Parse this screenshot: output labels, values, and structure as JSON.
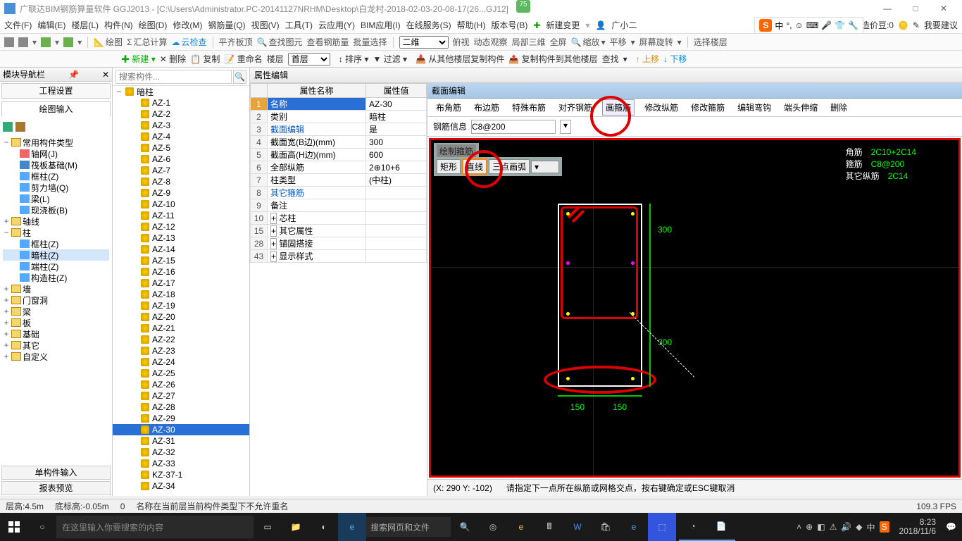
{
  "title": "广联达BIM钢筋算量软件 GGJ2013 - [C:\\Users\\Administrator.PC-20141127NRHM\\Desktop\\白龙村-2018-02-03-20-08-17(26...GJ12]",
  "badge": "75",
  "menubar": [
    "文件(F)",
    "编辑(E)",
    "楼层(L)",
    "构件(N)",
    "绘图(D)",
    "修改(M)",
    "钢筋量(Q)",
    "视图(V)",
    "工具(T)",
    "云应用(Y)",
    "BIM应用(I)",
    "在线服务(S)",
    "帮助(H)",
    "版本号(B)"
  ],
  "menu_right": {
    "new": "新建变更",
    "user": "广小二",
    "price": "造价豆:0",
    "feedback": "我要建议"
  },
  "toolbar1": [
    "绘图",
    "汇总计算",
    "云检查",
    "平齐板顶",
    "查找图元",
    "查看钢筋量",
    "批量选择",
    "二维",
    "俯视",
    "动态观察",
    "局部三维",
    "全屏",
    "缩放",
    "平移",
    "屏幕旋转",
    "选择楼层"
  ],
  "toolbar2": [
    "新建",
    "删除",
    "复制",
    "重命名",
    "楼层",
    "首层",
    "排序",
    "过滤",
    "从其他楼层复制构件",
    "复制构件到其他楼层",
    "查找",
    "上移",
    "下移"
  ],
  "dock": {
    "title": "模块导航栏",
    "tab1": "工程设置",
    "tab2": "绘图输入"
  },
  "tree": {
    "root": "常用构件类型",
    "items": [
      "轴网(J)",
      "筏板基础(M)",
      "框柱(Z)",
      "剪力墙(Q)",
      "梁(L)",
      "现浇板(B)"
    ],
    "n1": "轴线",
    "n2": "柱",
    "cols": [
      "框柱(Z)",
      "暗柱(Z)",
      "端柱(Z)",
      "构造柱(Z)"
    ],
    "others": [
      "墙",
      "门窗洞",
      "梁",
      "板",
      "基础",
      "其它",
      "自定义"
    ]
  },
  "bottom_tabs": [
    "单构件输入",
    "报表预览"
  ],
  "search_placeholder": "搜索构件...",
  "list_root": "暗柱",
  "list": [
    "AZ-1",
    "AZ-2",
    "AZ-3",
    "AZ-4",
    "AZ-5",
    "AZ-6",
    "AZ-7",
    "AZ-8",
    "AZ-9",
    "AZ-10",
    "AZ-11",
    "AZ-12",
    "AZ-13",
    "AZ-14",
    "AZ-15",
    "AZ-16",
    "AZ-17",
    "AZ-18",
    "AZ-19",
    "AZ-20",
    "AZ-21",
    "AZ-22",
    "AZ-23",
    "AZ-24",
    "AZ-25",
    "AZ-26",
    "AZ-27",
    "AZ-28",
    "AZ-29",
    "AZ-30",
    "AZ-31",
    "AZ-32",
    "AZ-33",
    "KZ-37-1",
    "AZ-34"
  ],
  "list_selected": "AZ-30",
  "prop_title": "属性编辑",
  "prop_head": {
    "name": "属性名称",
    "val": "属性值"
  },
  "props": [
    {
      "n": "1",
      "k": "名称",
      "v": "AZ-30",
      "sel": true
    },
    {
      "n": "2",
      "k": "类别",
      "v": "暗柱"
    },
    {
      "n": "3",
      "k": "截面编辑",
      "v": "是",
      "blue": true
    },
    {
      "n": "4",
      "k": "截面宽(B边)(mm)",
      "v": "300"
    },
    {
      "n": "5",
      "k": "截面高(H边)(mm)",
      "v": "600"
    },
    {
      "n": "6",
      "k": "全部纵筋",
      "v": "2⊕10+6"
    },
    {
      "n": "7",
      "k": "柱类型",
      "v": "(中柱)"
    },
    {
      "n": "8",
      "k": "其它箍筋",
      "v": "",
      "blue": true
    },
    {
      "n": "9",
      "k": "备注",
      "v": ""
    },
    {
      "n": "10",
      "k": "芯柱",
      "v": "",
      "plus": true
    },
    {
      "n": "15",
      "k": "其它属性",
      "v": "",
      "plus": true
    },
    {
      "n": "28",
      "k": "锚固搭接",
      "v": "",
      "plus": true
    },
    {
      "n": "43",
      "k": "显示样式",
      "v": "",
      "plus": true
    }
  ],
  "section": {
    "title": "截面编辑",
    "tabs": [
      "布角筋",
      "布边筋",
      "特殊布筋",
      "对齐钢筋",
      "画箍筋",
      "修改纵筋",
      "修改箍筋",
      "编辑弯钩",
      "端头伸缩",
      "删除"
    ],
    "active": "画箍筋",
    "info_label": "钢筋信息",
    "info_val": "C8@200",
    "draw_title": "绘制箍筋",
    "draw_btns": [
      "矩形",
      "直线",
      "三点画弧"
    ],
    "legend": {
      "a": "角筋",
      "av": "2C10+2C14",
      "b": "箍筋",
      "bv": "C8@200",
      "c": "其它纵筋",
      "cv": "2C14"
    },
    "dim300": "300",
    "dim150": "150",
    "coords": "(X: 290 Y: -102)",
    "hint": "请指定下一点所在纵筋或网格交点，按右键确定或ESC键取消"
  },
  "status": {
    "floor": "层高:4.5m",
    "bottom": "底标高:-0.05m",
    "cur": "0",
    "msg": "名称在当前层当前构件类型下不允许重名",
    "fps": "109.3 FPS"
  },
  "taskbar": {
    "search": "在这里输入你要搜索的内容",
    "browser": "搜索网页和文件",
    "ime": "中",
    "time": "8:23",
    "date": "2018/11/6"
  },
  "sogou": "中"
}
